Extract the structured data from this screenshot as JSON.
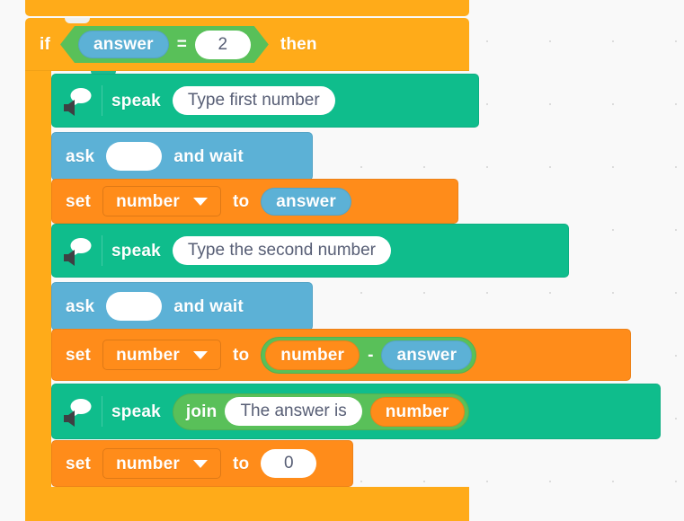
{
  "canvas": {
    "background_color": "#f9f9f9",
    "grid_dot_color": "#dcdcdc",
    "grid_spacing_px": 70
  },
  "palette": {
    "control_orange": "#ffab19",
    "variable_orange": "#ff8c1a",
    "sensing_blue": "#5cb1d6",
    "operator_green": "#59c059",
    "tts_green": "#0fbd8c",
    "input_white": "#ffffff",
    "input_text": "#575e75",
    "block_text": "#ffffff"
  },
  "script": {
    "if_block": {
      "if_label": "if",
      "then_label": "then",
      "condition": {
        "operator": "=",
        "left": {
          "type": "reporter-sensing",
          "label": "answer"
        },
        "right": {
          "type": "text-input",
          "value": "2"
        }
      },
      "body": [
        {
          "id": "speak-1",
          "type": "tts-speak",
          "icon": "speaker-speech-bubble-icon",
          "label": "speak",
          "argument": {
            "type": "text-input",
            "value": "Type first number"
          }
        },
        {
          "id": "ask-1",
          "type": "sensing-ask",
          "label_left": "ask",
          "label_right": "and wait",
          "argument": {
            "type": "text-input",
            "value": ""
          }
        },
        {
          "id": "set-1",
          "type": "variable-set",
          "label_left": "set",
          "label_right": "to",
          "variable": "number",
          "value": {
            "type": "reporter-sensing",
            "label": "answer"
          }
        },
        {
          "id": "speak-2",
          "type": "tts-speak",
          "icon": "speaker-speech-bubble-icon",
          "label": "speak",
          "argument": {
            "type": "text-input",
            "value": "Type the second number"
          }
        },
        {
          "id": "ask-2",
          "type": "sensing-ask",
          "label_left": "ask",
          "label_right": "and wait",
          "argument": {
            "type": "text-input",
            "value": ""
          }
        },
        {
          "id": "set-2",
          "type": "variable-set",
          "label_left": "set",
          "label_right": "to",
          "variable": "number",
          "value": {
            "type": "operator-subtract",
            "operator": "-",
            "left": {
              "type": "reporter-variable",
              "label": "number"
            },
            "right": {
              "type": "reporter-sensing",
              "label": "answer"
            }
          }
        },
        {
          "id": "speak-3",
          "type": "tts-speak",
          "icon": "speaker-speech-bubble-icon",
          "label": "speak",
          "argument": {
            "type": "operator-join",
            "label": "join",
            "left": {
              "type": "text-input",
              "value": "The answer is"
            },
            "right": {
              "type": "reporter-variable",
              "label": "number"
            }
          }
        },
        {
          "id": "set-3",
          "type": "variable-set",
          "label_left": "set",
          "label_right": "to",
          "variable": "number",
          "value": {
            "type": "text-input",
            "value": "0"
          }
        }
      ]
    }
  }
}
